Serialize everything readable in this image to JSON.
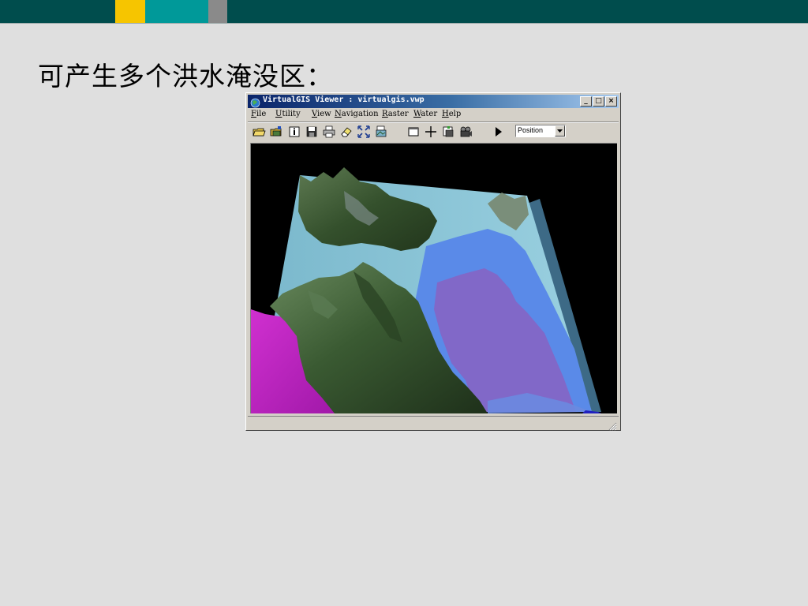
{
  "slide": {
    "title": "可产生多个洪水淹没区："
  },
  "window": {
    "title": "VirtualGIS Viewer : virtualgis.vwp",
    "app_icon": "globe-icon",
    "controls": {
      "minimize": "_",
      "maximize": "□",
      "close": "×"
    }
  },
  "menu": {
    "items": [
      "File",
      "Utility",
      "View",
      "Navigation",
      "Raster",
      "Water",
      "Help"
    ]
  },
  "toolbar": {
    "icons": [
      "open-folder-icon",
      "open-image-icon",
      "info-icon",
      "save-icon",
      "print-icon",
      "eraser-icon",
      "fit-extent-icon",
      "layers-icon",
      "frame-icon",
      "crosshair-icon",
      "snapshot-icon",
      "camera-icon",
      "play-icon"
    ],
    "mode_select": {
      "value": "Position"
    }
  },
  "colors": {
    "title_gradient_start": "#0a246a",
    "title_gradient_end": "#a6caf0",
    "flood_purple": "#8168c8",
    "flood_blue": "#5588e8",
    "flood_cyan": "#86c8d8",
    "flood_magenta": "#c020c0",
    "terrain_green": "#3a5a34"
  }
}
